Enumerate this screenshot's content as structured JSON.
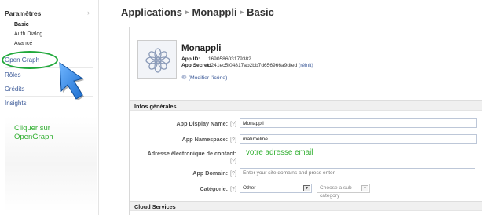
{
  "sidebar": {
    "section_label": "Paramètres",
    "sub_items": [
      "Basic",
      "Auth Dialog",
      "Avancé"
    ],
    "items": [
      "Open Graph",
      "Rôles",
      "Crédits",
      "Insights"
    ],
    "hint_lines": [
      "Cliquer sur",
      "OpenGraph"
    ]
  },
  "breadcrumb": [
    "Applications",
    "Monappli",
    "Basic"
  ],
  "app": {
    "name": "Monappli",
    "id_label": "App ID:",
    "id_value": "169058603179382",
    "secret_label": "App Secret:",
    "secret_value": "d241ec5f04817ab2bb7d656966a9dfed",
    "reset_link": "(réinit)",
    "modify_icon": "(Modifier l'icône)"
  },
  "sections": {
    "general": "Infos générales",
    "cloud": "Cloud Services"
  },
  "fields": {
    "display_name_label": "App Display Name:",
    "display_name_value": "Monappli",
    "namespace_label": "App Namespace:",
    "namespace_value": "matimeline",
    "contact_label": "Adresse électronique de contact:",
    "contact_hint": "votre adresse email",
    "domain_label": "App Domain:",
    "domain_placeholder": "Enter your site domains and press enter",
    "category_label": "Catégorie:",
    "category_value": "Other",
    "subcategory_placeholder": "Choose a sub-category",
    "help_mark": "[?]"
  },
  "colors": {
    "link": "#3b5998",
    "annotation_green": "#2fae2f",
    "arrow_blue": "#2f86e3"
  },
  "icons": [
    "chevron-right-icon",
    "cursor-arrow-icon",
    "app-logo-icon",
    "gear-icon",
    "dropdown-arrow-icon"
  ]
}
